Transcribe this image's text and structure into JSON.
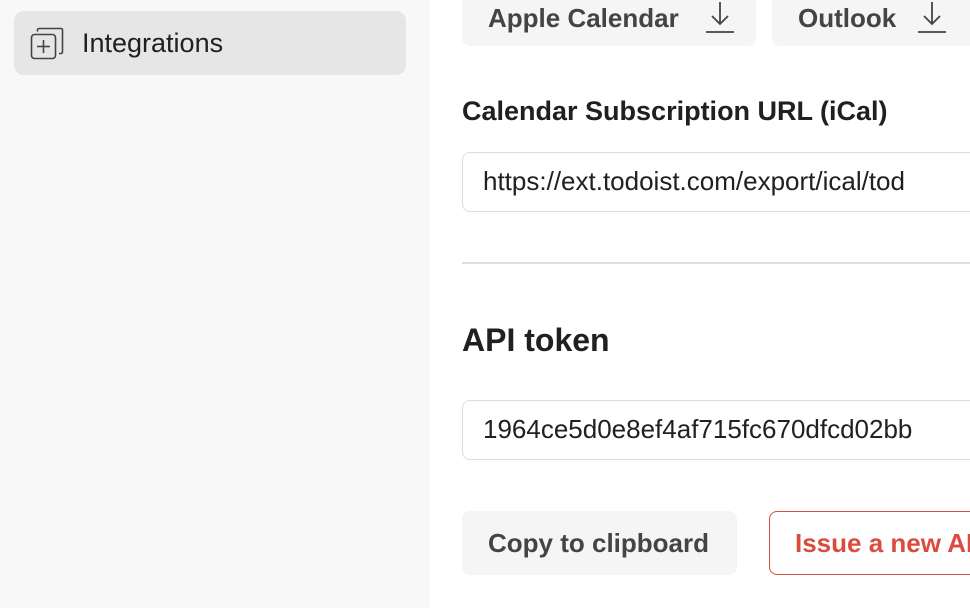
{
  "sidebar": {
    "items": [
      {
        "label": "Integrations",
        "icon": "plus-square-stack-icon"
      }
    ]
  },
  "calendar": {
    "buttons": [
      {
        "label": "Apple Calendar",
        "icon": "download-icon"
      },
      {
        "label": "Outlook",
        "icon": "download-icon"
      }
    ],
    "ical_label": "Calendar Subscription URL (iCal)",
    "ical_url": "https://ext.todoist.com/export/ical/tod"
  },
  "api": {
    "title": "API token",
    "token": "1964ce5d0e8ef4af715fc670dfcd02bb",
    "copy_label": "Copy to clipboard",
    "issue_label": "Issue a new AI"
  },
  "colors": {
    "accent": "#dc4c3e",
    "sidebar_bg": "#f8f8f8",
    "selected_bg": "#e6e6e6"
  }
}
